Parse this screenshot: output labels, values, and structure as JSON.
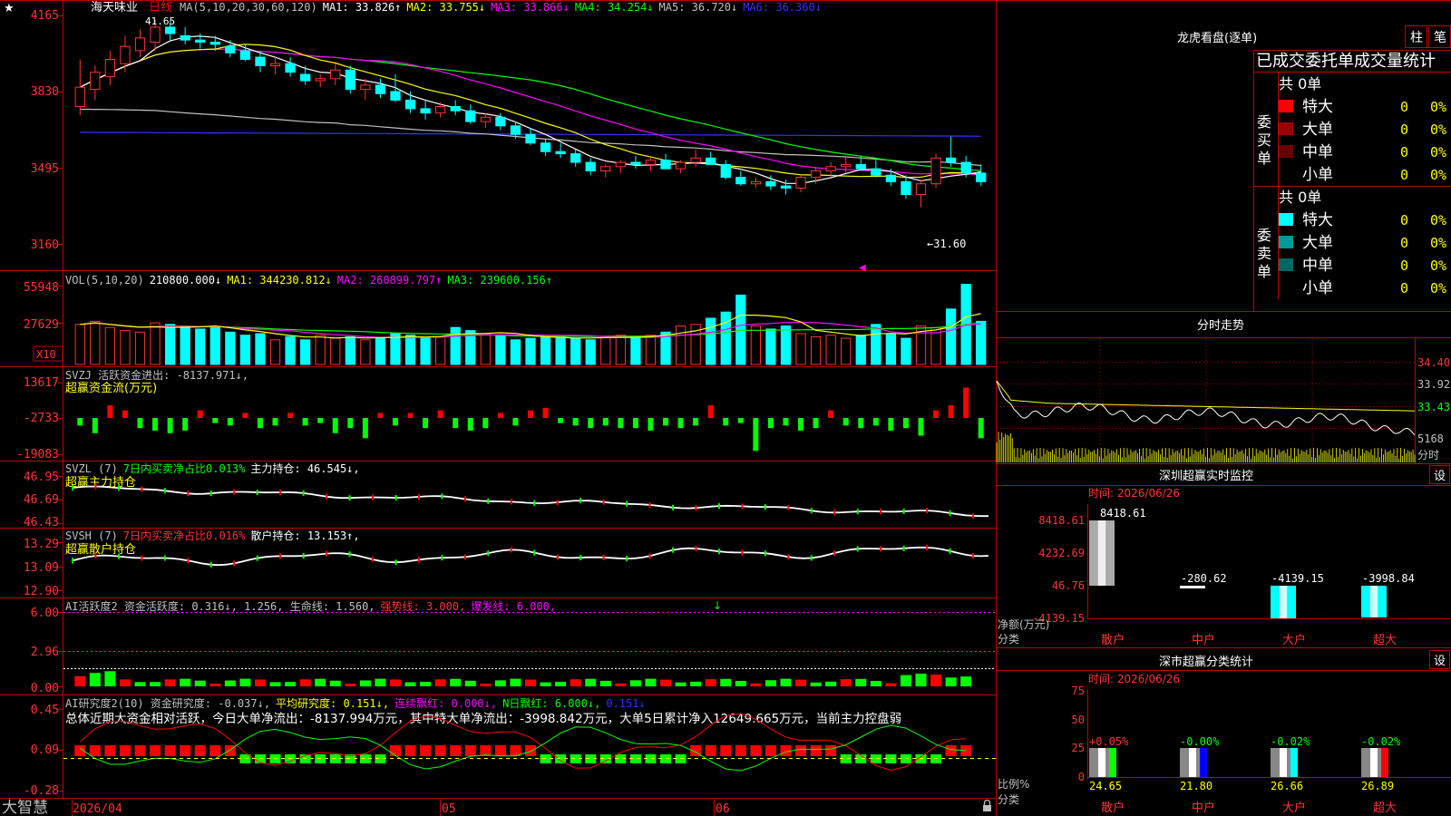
{
  "app": {
    "brand": "大智慧",
    "stock_name": "海天味业",
    "period": "日线",
    "lock_icon": "lock-icon"
  },
  "price_panel": {
    "header": [
      {
        "text": "MA(5,10,20,30,60,120)",
        "color": "#c0c0c0"
      },
      {
        "text": "MA1: 33.826↑",
        "color": "#ffffff"
      },
      {
        "text": "MA2: 33.755↓",
        "color": "#ffff00"
      },
      {
        "text": "MA3: 33.866↓",
        "color": "#ff00ff"
      },
      {
        "text": "MA4: 34.254↓",
        "color": "#00ff00"
      },
      {
        "text": "MA5: 36.720↓",
        "color": "#c0c0c0"
      },
      {
        "text": "MA6: 36.360↓",
        "color": "#3333ff"
      }
    ],
    "y_labels": [
      "4165",
      "3830",
      "3495",
      "3160"
    ],
    "high_label": "41.65",
    "low_label": "←31.60"
  },
  "vol_panel": {
    "header": [
      {
        "text": "VOL(5,10,20)",
        "color": "#c0c0c0"
      },
      {
        "text": "210800.000↓",
        "color": "#ffffff"
      },
      {
        "text": "MA1: 344230.812↓",
        "color": "#ffff00"
      },
      {
        "text": "MA2: 260899.797↑",
        "color": "#ff00ff"
      },
      {
        "text": "MA3: 239600.156↑",
        "color": "#00ff00"
      }
    ],
    "y_labels": [
      "55948",
      "27629"
    ],
    "unit": "X10"
  },
  "svzj_panel": {
    "header": [
      {
        "text": "SVZJ  活跃资金进出: -8137.971↓,",
        "color": "#c0c0c0"
      }
    ],
    "subtitle": "超赢资金流(万元)",
    "y_labels": [
      "13617",
      "-2733",
      "-19083"
    ]
  },
  "svzl_panel": {
    "header": [
      {
        "text": "SVZL (7)",
        "color": "#c0c0c0"
      },
      {
        "text": "7日内买卖净占比0.013%",
        "color": "#00ff00"
      },
      {
        "text": "主力持仓: 46.545↓,",
        "color": "#ffffff"
      }
    ],
    "subtitle": "超赢主力持仓",
    "y_labels": [
      "46.95",
      "46.69",
      "46.43"
    ]
  },
  "svsh_panel": {
    "header": [
      {
        "text": "SVSH (7)",
        "color": "#c0c0c0"
      },
      {
        "text": "7日内买卖净占比0.016%",
        "color": "#ff3333"
      },
      {
        "text": "散户持仓: 13.153↑,",
        "color": "#ffffff"
      }
    ],
    "subtitle": "超赢散户持仓",
    "y_labels": [
      "13.29",
      "13.09",
      "12.90"
    ]
  },
  "ai_active_panel": {
    "header": [
      {
        "text": "AI活跃度2 资金活跃度: 0.316↓, 1.256, 生命线: 1.560,",
        "color": "#c0c0c0"
      },
      {
        "text": "强势线: 3.000,",
        "color": "#ff3333"
      },
      {
        "text": "爆发线: 6.000,",
        "color": "#ff00ff"
      }
    ],
    "y_labels": [
      "6.00",
      "2.96",
      "0.00"
    ]
  },
  "ai_research_panel": {
    "header": [
      {
        "text": "AI研究度2(10) 资金研究度: -0.037↓,",
        "color": "#c0c0c0"
      },
      {
        "text": "平均研究度: 0.151↓,",
        "color": "#ffff00"
      },
      {
        "text": "连续飘红: 0.000↓,",
        "color": "#ff00ff"
      },
      {
        "text": "N日飘红: 6.000↓,",
        "color": "#00ff00"
      },
      {
        "text": "0.151↓",
        "color": "#3333ff"
      }
    ],
    "summary": "总体近期大资金相对活跃，今日大单净流出：-8137.994万元，其中特大单净流出：-3998.842万元，大单5日累计净入12649.665万元，当前主力控盘弱",
    "y_labels": [
      "0.45",
      "0.09",
      "-0.28"
    ]
  },
  "x_axis": [
    "2026/04",
    "05",
    "06"
  ],
  "right": {
    "lhb_title": "龙虎看盘(逐单)",
    "btn_zhu": "柱",
    "btn_bi": "笔",
    "stats_title": "已成交委托单成交量统计",
    "buy_side": {
      "label": "委买单",
      "total": "共 0单",
      "rows": [
        {
          "name": "特大",
          "count": "0",
          "pct": "0%",
          "color": "#ff0000"
        },
        {
          "name": "大单",
          "count": "0",
          "pct": "0%",
          "color": "#990000"
        },
        {
          "name": "中单",
          "count": "0",
          "pct": "0%",
          "color": "#660000"
        },
        {
          "name": "小单",
          "count": "0",
          "pct": "0%",
          "color": "#000000"
        }
      ]
    },
    "sell_side": {
      "label": "委卖单",
      "total": "共 0单",
      "rows": [
        {
          "name": "特大",
          "count": "0",
          "pct": "0%",
          "color": "#00ffff"
        },
        {
          "name": "大单",
          "count": "0",
          "pct": "0%",
          "color": "#009999"
        },
        {
          "name": "中单",
          "count": "0",
          "pct": "0%",
          "color": "#006666"
        },
        {
          "name": "小单",
          "count": "0",
          "pct": "0%",
          "color": "#000000"
        }
      ]
    },
    "intraday": {
      "title": "分时走势",
      "y_labels": [
        "34.40",
        "33.92",
        "33.43"
      ],
      "vol_label": "5168",
      "unit_label": "分时"
    },
    "monitor": {
      "title": "深圳超赢实时监控",
      "set_btn": "设",
      "time": "时间: 2026/06/26",
      "y_labels": [
        "8418.61",
        "4232.69",
        "46.76",
        "-4139.15"
      ],
      "axis_name_1": "净额(万元)",
      "axis_name_2": "分类",
      "categories": [
        "散户",
        "中户",
        "大户",
        "超大"
      ],
      "values_text": [
        "8418.61",
        "-280.62",
        "-4139.15",
        "-3998.84"
      ]
    },
    "classify": {
      "title": "深市超赢分类统计",
      "set_btn": "设",
      "time": "时间: 2026/06/26",
      "y_labels": [
        "75",
        "50",
        "25",
        "0"
      ],
      "axis_name_1": "比例%",
      "axis_name_2": "分类",
      "categories": [
        "散户",
        "中户",
        "大户",
        "超大"
      ],
      "change_text": [
        "+0.05%",
        "-0.00%",
        "-0.02%",
        "-0.02%"
      ],
      "ratio_text": [
        "24.65",
        "21.80",
        "26.66",
        "26.89"
      ]
    }
  },
  "chart_data": [
    {
      "type": "candlestick",
      "name": "daily-kline",
      "y_range": [
        31.2,
        42.1
      ],
      "ohlc": [
        [
          37.6,
          39.8,
          37.2,
          38.5
        ],
        [
          38.4,
          39.5,
          37.9,
          39.2
        ],
        [
          39.0,
          40.2,
          38.6,
          39.8
        ],
        [
          39.6,
          40.9,
          39.2,
          40.4
        ],
        [
          40.2,
          41.2,
          39.9,
          40.8
        ],
        [
          40.6,
          41.65,
          40.2,
          41.3
        ],
        [
          41.3,
          41.6,
          40.7,
          41.0
        ],
        [
          40.9,
          41.3,
          40.5,
          40.7
        ],
        [
          40.7,
          41.0,
          40.3,
          40.6
        ],
        [
          40.6,
          40.9,
          40.2,
          40.5
        ],
        [
          40.4,
          40.7,
          39.9,
          40.1
        ],
        [
          40.2,
          40.5,
          39.7,
          39.8
        ],
        [
          39.9,
          40.2,
          39.2,
          39.5
        ],
        [
          39.5,
          39.9,
          39.1,
          39.6
        ],
        [
          39.6,
          39.9,
          39.0,
          39.2
        ],
        [
          39.1,
          39.5,
          38.6,
          38.8
        ],
        [
          38.8,
          39.1,
          38.5,
          38.9
        ],
        [
          38.9,
          39.6,
          38.6,
          39.3
        ],
        [
          39.3,
          39.5,
          38.2,
          38.4
        ],
        [
          38.4,
          38.9,
          37.9,
          38.6
        ],
        [
          38.6,
          38.9,
          38.0,
          38.2
        ],
        [
          38.3,
          39.1,
          37.8,
          37.9
        ],
        [
          37.9,
          38.3,
          37.3,
          37.5
        ],
        [
          37.5,
          37.9,
          37.0,
          37.3
        ],
        [
          37.3,
          37.8,
          37.1,
          37.6
        ],
        [
          37.6,
          37.9,
          37.2,
          37.4
        ],
        [
          37.4,
          37.7,
          36.8,
          36.9
        ],
        [
          36.9,
          37.3,
          36.6,
          37.1
        ],
        [
          37.1,
          37.3,
          36.5,
          36.7
        ],
        [
          36.7,
          36.9,
          36.1,
          36.3
        ],
        [
          36.3,
          36.6,
          35.8,
          35.9
        ],
        [
          35.9,
          36.1,
          35.3,
          35.5
        ],
        [
          35.5,
          35.9,
          35.2,
          35.4
        ],
        [
          35.4,
          35.6,
          34.8,
          35.0
        ],
        [
          35.0,
          35.2,
          34.4,
          34.6
        ],
        [
          34.6,
          34.9,
          34.3,
          34.8
        ],
        [
          34.8,
          35.1,
          34.5,
          35.0
        ],
        [
          35.0,
          35.3,
          34.7,
          34.9
        ],
        [
          34.9,
          35.2,
          34.6,
          35.1
        ],
        [
          35.1,
          35.4,
          34.8,
          34.7
        ],
        [
          34.7,
          35.1,
          34.5,
          35.0
        ],
        [
          35.0,
          35.6,
          34.8,
          35.2
        ],
        [
          35.2,
          35.5,
          34.9,
          34.9
        ],
        [
          34.9,
          35.1,
          34.2,
          34.3
        ],
        [
          34.3,
          34.6,
          33.9,
          34.0
        ],
        [
          34.0,
          34.3,
          33.8,
          34.1
        ],
        [
          34.1,
          34.4,
          33.7,
          33.9
        ],
        [
          33.9,
          34.2,
          33.5,
          33.8
        ],
        [
          33.8,
          34.4,
          33.6,
          34.3
        ],
        [
          34.3,
          34.8,
          34.0,
          34.6
        ],
        [
          34.6,
          35.0,
          34.3,
          34.8
        ],
        [
          34.8,
          35.2,
          34.5,
          34.9
        ],
        [
          34.9,
          35.3,
          34.6,
          34.7
        ],
        [
          34.7,
          35.1,
          34.3,
          34.4
        ],
        [
          34.4,
          34.7,
          33.9,
          34.1
        ],
        [
          34.1,
          34.4,
          33.3,
          33.5
        ],
        [
          33.5,
          34.2,
          32.9,
          34.0
        ],
        [
          34.0,
          35.4,
          33.8,
          35.2
        ],
        [
          35.2,
          36.2,
          34.8,
          35.0
        ],
        [
          35.0,
          35.3,
          34.3,
          34.5
        ],
        [
          34.5,
          34.9,
          33.9,
          34.1
        ]
      ]
    },
    {
      "type": "bar",
      "name": "volume",
      "y_range": [
        0,
        60000
      ],
      "values": [
        26000,
        28000,
        24000,
        22000,
        21000,
        27000,
        26000,
        25000,
        23000,
        24000,
        21000,
        19000,
        20000,
        16000,
        18000,
        16000,
        19000,
        17000,
        18000,
        16000,
        17000,
        20000,
        19000,
        17000,
        18000,
        24000,
        22000,
        20000,
        19000,
        16000,
        17000,
        18000,
        18000,
        17000,
        16000,
        18000,
        19000,
        18000,
        19000,
        21000,
        25000,
        26000,
        30000,
        34000,
        45000,
        25000,
        23000,
        25000,
        20000,
        18000,
        19000,
        17000,
        19000,
        26000,
        20000,
        17000,
        25000,
        24000,
        36000,
        52000,
        28000,
        21000
      ]
    },
    {
      "type": "bar",
      "name": "svzj-fund-flow",
      "y_range": [
        -19083,
        13617
      ],
      "values": [
        -3000,
        -6000,
        5000,
        3000,
        -4000,
        -5000,
        -6000,
        -5000,
        3000,
        -2000,
        -3000,
        2000,
        -4000,
        -3000,
        2000,
        -3000,
        -2000,
        -6000,
        -4000,
        -8000,
        2000,
        -3000,
        2000,
        -4000,
        3000,
        -4000,
        -5000,
        -4000,
        2000,
        -3000,
        3000,
        4000,
        -2000,
        -3000,
        -4000,
        -3000,
        -4000,
        -4000,
        -5000,
        -3000,
        -4000,
        -3000,
        5000,
        -3000,
        -2000,
        -13000,
        -4000,
        -3000,
        -5000,
        -4000,
        3000,
        -3000,
        -4000,
        -3000,
        -5000,
        -4000,
        -7000,
        3000,
        5000,
        12000,
        -8000
      ]
    }
  ]
}
